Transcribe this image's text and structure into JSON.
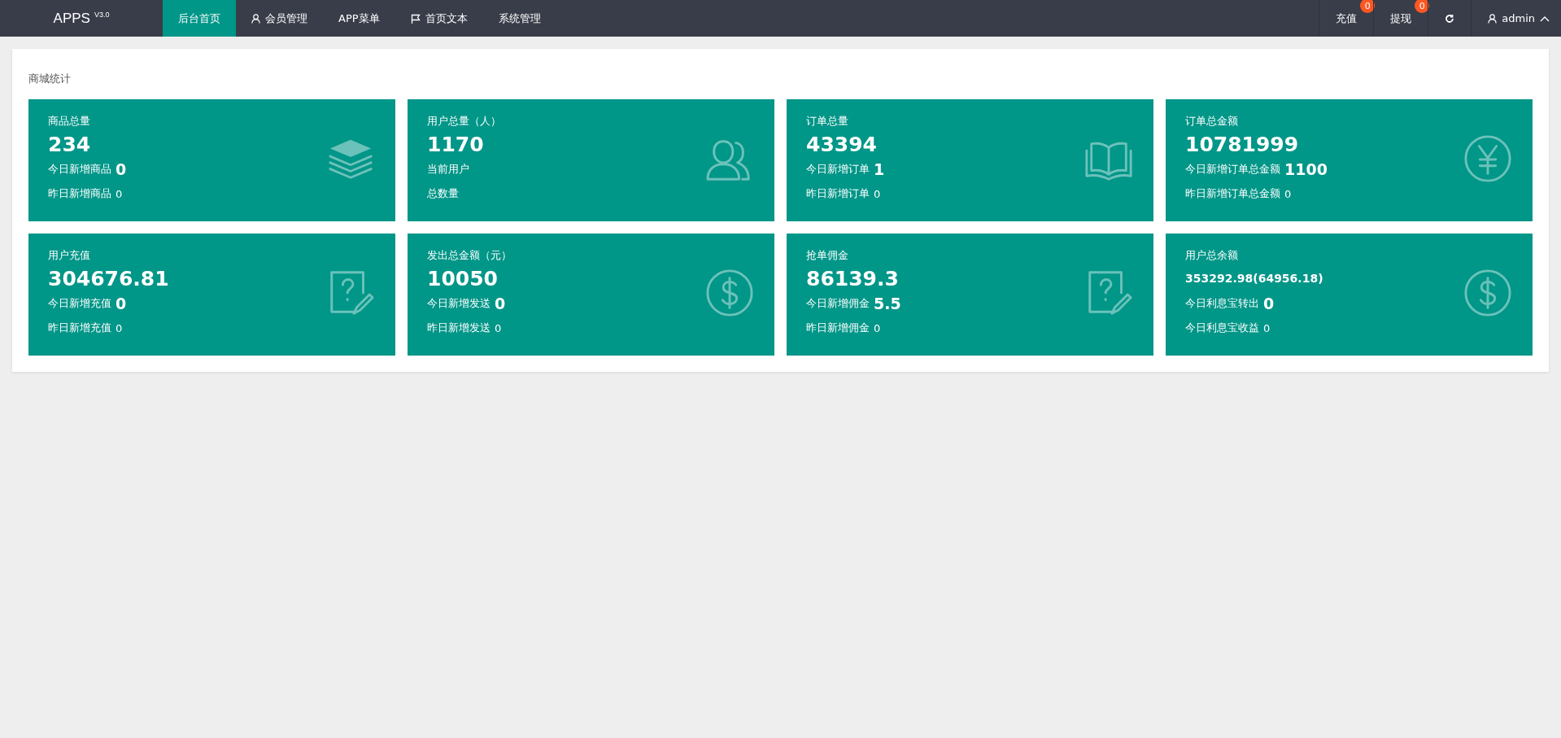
{
  "brand": {
    "name": "APPS",
    "version": "V3.0"
  },
  "nav": [
    {
      "label": "后台首页",
      "selected": true,
      "kind": "plain"
    },
    {
      "label": "会员管理",
      "selected": false,
      "kind": "user"
    },
    {
      "label": "APP菜单",
      "selected": false,
      "kind": "plain"
    },
    {
      "label": "首页文本",
      "selected": false,
      "kind": "flag"
    },
    {
      "label": "系统管理",
      "selected": false,
      "kind": "plain"
    }
  ],
  "right": [
    {
      "kind": "badge",
      "label": "充值",
      "badge": "0"
    },
    {
      "kind": "badge",
      "label": "提现",
      "badge": "0"
    },
    {
      "kind": "refresh"
    },
    {
      "kind": "user",
      "label": "admin"
    }
  ],
  "panel": {
    "title": "商城统计",
    "cards": [
      {
        "title": "商品总量",
        "value": "234",
        "compact": false,
        "kind": "layers",
        "lines": [
          {
            "label": "今日新增商品",
            "value": "0"
          },
          {
            "label": "昨日新增商品",
            "value": "0"
          }
        ]
      },
      {
        "title": "用户总量（人）",
        "value": "1170",
        "compact": false,
        "kind": "users",
        "lines": [
          {
            "label": "当前用户"
          },
          {
            "label": "总数量"
          }
        ]
      },
      {
        "title": "订单总量",
        "value": "43394",
        "compact": false,
        "kind": "book",
        "lines": [
          {
            "label": "今日新增订单",
            "value": "1"
          },
          {
            "label": "昨日新增订单",
            "value": "0"
          }
        ]
      },
      {
        "title": "订单总金额",
        "value": "10781999",
        "compact": false,
        "kind": "yen",
        "lines": [
          {
            "label": "今日新增订单总金额",
            "value": "1100"
          },
          {
            "label": "昨日新增订单总金额",
            "value": "0"
          }
        ]
      },
      {
        "title": "用户充值",
        "value": "304676.81",
        "compact": false,
        "kind": "note",
        "lines": [
          {
            "label": "今日新增充值",
            "value": "0"
          },
          {
            "label": "昨日新增充值",
            "value": "0"
          }
        ]
      },
      {
        "title": "发出总金额（元）",
        "value": "10050",
        "compact": false,
        "kind": "dollar",
        "lines": [
          {
            "label": "今日新增发送",
            "value": "0"
          },
          {
            "label": "昨日新增发送",
            "value": "0"
          }
        ]
      },
      {
        "title": "抢单佣金",
        "value": "86139.3",
        "compact": false,
        "kind": "note",
        "lines": [
          {
            "label": "今日新增佣金",
            "value": "5.5"
          },
          {
            "label": "昨日新增佣金",
            "value": "0"
          }
        ]
      },
      {
        "title": "用户总余额",
        "value": "353292.98(64956.18)",
        "compact": true,
        "kind": "dollar",
        "lines": [
          {
            "label": "今日利息宝转出",
            "value": "0"
          },
          {
            "label": "今日利息宝收益",
            "value": "0"
          }
        ]
      }
    ]
  }
}
